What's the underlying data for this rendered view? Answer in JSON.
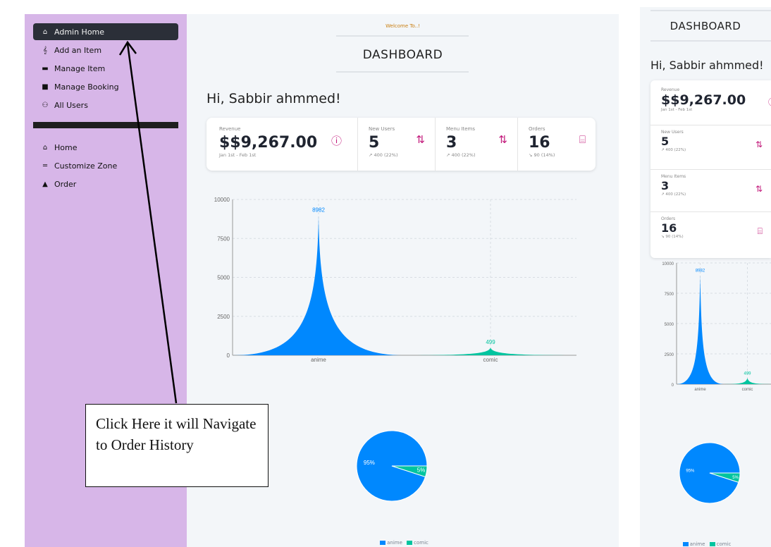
{
  "sidebar": {
    "items": [
      {
        "label": "Admin Home",
        "icon": "home-icon"
      },
      {
        "label": "Add an Item",
        "icon": "utensils-icon"
      },
      {
        "label": "Manage Item",
        "icon": "wallet-icon"
      },
      {
        "label": "Manage Booking",
        "icon": "book-icon"
      },
      {
        "label": "All Users",
        "icon": "users-icon"
      }
    ],
    "items2": [
      {
        "label": "Home",
        "icon": "home-icon"
      },
      {
        "label": "Customize Zone",
        "icon": "bars-icon"
      },
      {
        "label": "Order",
        "icon": "bag-icon"
      }
    ]
  },
  "main": {
    "welcome": "Welcome To..!",
    "title": "DASHBOARD",
    "greeting": "Hi, Sabbir ahmmed!",
    "stats": {
      "revenue": {
        "label": "Revenue",
        "value": "$$9,267.00",
        "sub": "Jan 1st - Feb 1st"
      },
      "users": {
        "label": "New Users",
        "value": "5",
        "sub": "↗ 400 (22%)"
      },
      "menu": {
        "label": "Menu Items",
        "value": "3",
        "sub": "↗ 400 (22%)"
      },
      "orders": {
        "label": "Orders",
        "value": "16",
        "sub": "↘ 90 (14%)"
      }
    },
    "legend": {
      "a": "anime",
      "b": "comic"
    }
  },
  "callout": {
    "text": "Click Here it will Navigate to Order History"
  },
  "mobile": {
    "title": "DASHBOARD",
    "greeting": "Hi, Sabbir ahmmed!"
  },
  "colors": {
    "anime": "#0088fe",
    "comic": "#00c49f",
    "accent": "#c2187a",
    "sidebar": "#d7b6e8"
  },
  "chart_data": [
    {
      "type": "area",
      "categories": [
        "anime",
        "comic"
      ],
      "values": [
        8982,
        499
      ],
      "ylim": [
        0,
        10000
      ],
      "yticks": [
        0,
        2500,
        5000,
        7500,
        10000
      ],
      "grid": true
    },
    {
      "type": "pie",
      "labels": [
        "anime",
        "comic"
      ],
      "values": [
        95,
        5
      ],
      "value_labels": [
        "95%",
        "5%"
      ],
      "legend": "bottom"
    }
  ]
}
